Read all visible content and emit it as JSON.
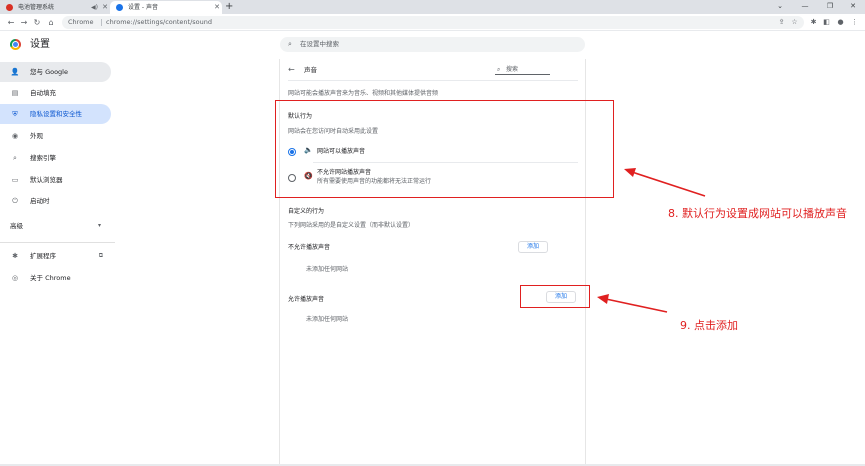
{
  "browser": {
    "tabs": [
      {
        "title": "电池管理系统",
        "favicon_color": "#d93025",
        "has_audio": true
      },
      {
        "title": "设置 - 声音",
        "favicon_color": "#1a73e8",
        "active": true
      }
    ],
    "new_tab": "+",
    "window_controls": {
      "chevron": "⌄",
      "minimize": "—",
      "restore": "❐",
      "close": "✕"
    },
    "nav": {
      "back": "←",
      "forward": "→",
      "reload": "↻",
      "home": "⌂"
    },
    "omnibox": {
      "site_label": "Chrome",
      "url": "chrome://settings/content/sound"
    },
    "toolbar_icons": {
      "share": "⇪",
      "star": "☆",
      "extensions": "✱",
      "sidebar": "◧",
      "profile": "●",
      "menu": "⋮"
    }
  },
  "settings_header": {
    "title": "设置",
    "search_placeholder": "在设置中搜索"
  },
  "sidebar": {
    "items": [
      {
        "label": "您与 Google",
        "icon": "👤"
      },
      {
        "label": "自动填充",
        "icon": "▤"
      },
      {
        "label": "隐私设置和安全性",
        "icon": "⛨"
      },
      {
        "label": "外观",
        "icon": "◉"
      },
      {
        "label": "搜索引擎",
        "icon": "⌕"
      },
      {
        "label": "默认浏览器",
        "icon": "▭"
      },
      {
        "label": "启动时",
        "icon": "⏻"
      },
      {
        "label": "高级",
        "icon": "▾"
      },
      {
        "label": "扩展程序",
        "icon": "✱",
        "trailing": "⧉"
      },
      {
        "label": "关于 Chrome",
        "icon": "◎"
      }
    ]
  },
  "content": {
    "back": "←",
    "heading": "声音",
    "search_placeholder": "搜索",
    "description": "网站可能会播放声音来为音乐、视频和其他媒体提供音频",
    "default_behavior": {
      "title": "默认行为",
      "subtitle": "网站会在您访问时自动采用此设置",
      "options": [
        {
          "label": "网站可以播放声音",
          "icon": "🔈",
          "selected": true
        },
        {
          "label": "不允许网站播放声音",
          "sublabel": "所有需要使用声音的功能都将无法正常运行",
          "icon": "🔇",
          "selected": false
        }
      ]
    },
    "custom_behavior": {
      "title": "自定义的行为",
      "subtitle": "下列网站采用的是自定义设置（而非默认设置）",
      "blocked": {
        "title": "不允许播放声音",
        "add_label": "添加",
        "empty": "未添加任何网站"
      },
      "allowed": {
        "title": "允许播放声音",
        "add_label": "添加",
        "empty": "未添加任何网站"
      }
    }
  },
  "annotations": {
    "step8": "8. 默认行为设置成网站可以播放声音",
    "step9": "9. 点击添加",
    "color": "#e02020"
  }
}
